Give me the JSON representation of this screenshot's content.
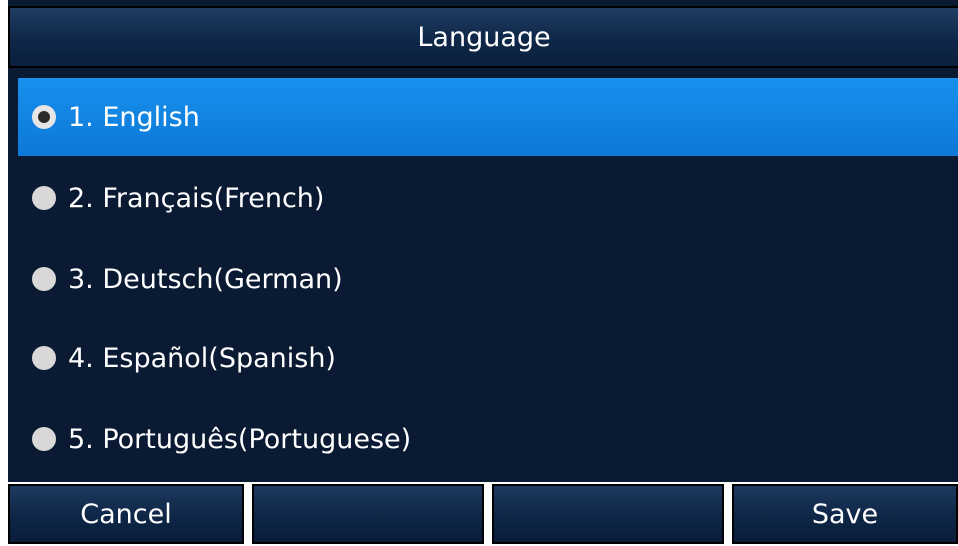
{
  "header": {
    "title": "Language"
  },
  "languages": [
    {
      "label": "1. English",
      "selected": true
    },
    {
      "label": "2. Français(French)",
      "selected": false
    },
    {
      "label": "3. Deutsch(German)",
      "selected": false
    },
    {
      "label": "4. Español(Spanish)",
      "selected": false
    },
    {
      "label": "5. Português(Portuguese)",
      "selected": false
    }
  ],
  "softkeys": {
    "key1": "Cancel",
    "key2": "",
    "key3": "",
    "key4": "Save"
  },
  "colors": {
    "background": "#0a1a33",
    "selection": "#1890ee",
    "text": "#ffffff"
  }
}
